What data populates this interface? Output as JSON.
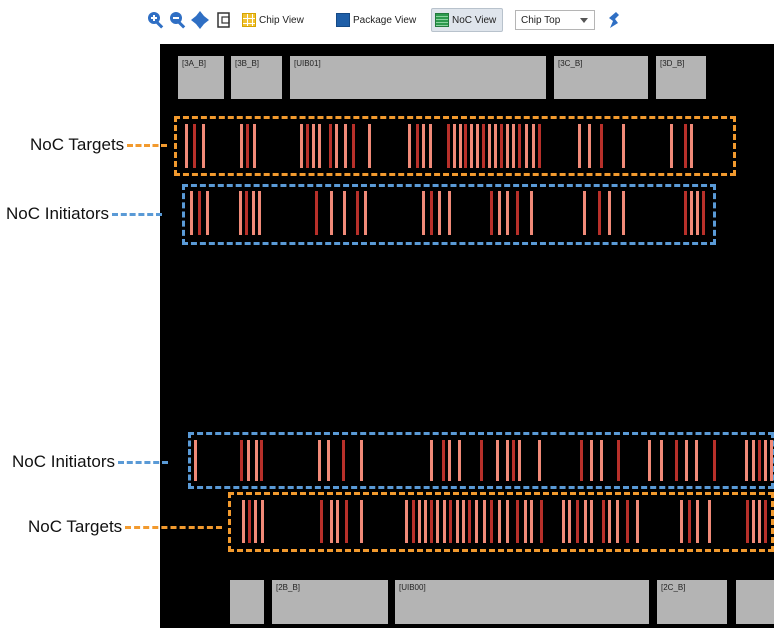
{
  "toolbar": {
    "icons": [
      "zoom-in-icon",
      "zoom-out-icon",
      "pan-icon",
      "fit-icon"
    ],
    "chip_view": "Chip View",
    "package_view": "Package View",
    "noc_view": "NoC View",
    "select_value": "Chip Top"
  },
  "banks_top": [
    "[3A_B]",
    "[3B_B]",
    "[UIB01]",
    "[3C_B]",
    "[3D_B]"
  ],
  "banks_bottom": [
    "",
    "[2B_B]",
    "[UIB00]",
    "[2C_B]",
    ""
  ],
  "callouts": {
    "targets_top": "NoC Targets",
    "initiators_top": "NoC Initiators",
    "initiators_bottom": "NoC Initiators",
    "targets_bottom": "NoC Targets"
  },
  "colors": {
    "target_border": "#f29a2e",
    "initiator_border": "#5a9ad6",
    "bar_bright": "#f08a78",
    "bar_dark": "#b8302a"
  }
}
